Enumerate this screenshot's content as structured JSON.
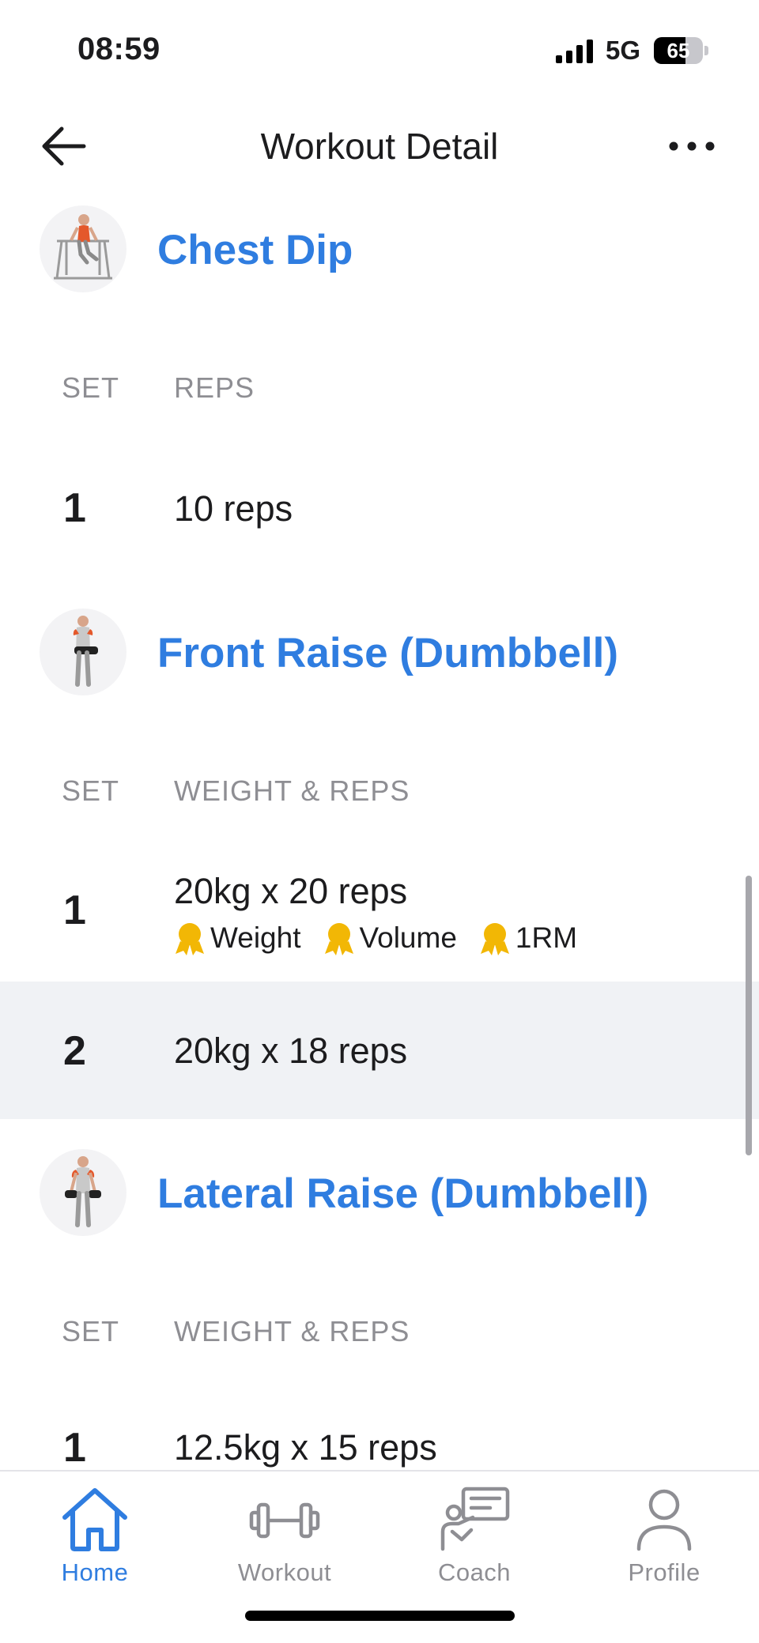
{
  "status_bar": {
    "time": "08:59",
    "network": "5G",
    "battery_level": "65",
    "battery_fraction": 0.65
  },
  "nav": {
    "title": "Workout Detail"
  },
  "exercises": [
    {
      "name": "Chest Dip",
      "columns": {
        "set": "SET",
        "detail": "REPS"
      },
      "sets": [
        {
          "number": "1",
          "detail": "10 reps"
        }
      ]
    },
    {
      "name": "Front Raise (Dumbbell)",
      "columns": {
        "set": "SET",
        "detail": "WEIGHT & REPS"
      },
      "sets": [
        {
          "number": "1",
          "detail": "20kg x 20 reps",
          "badges": [
            "Weight",
            "Volume",
            "1RM"
          ]
        },
        {
          "number": "2",
          "detail": "20kg x 18 reps"
        }
      ]
    },
    {
      "name": "Lateral Raise (Dumbbell)",
      "columns": {
        "set": "SET",
        "detail": "WEIGHT & REPS"
      },
      "sets": [
        {
          "number": "1",
          "detail": "12.5kg x 15 reps"
        }
      ]
    }
  ],
  "tab_bar": {
    "tabs": [
      {
        "label": "Home",
        "icon": "home-icon",
        "active": true
      },
      {
        "label": "Workout",
        "icon": "dumbbell-icon",
        "active": false
      },
      {
        "label": "Coach",
        "icon": "coach-icon",
        "active": false
      },
      {
        "label": "Profile",
        "icon": "person-icon",
        "active": false
      }
    ]
  },
  "colors": {
    "accent": "#2f7de0",
    "inactive": "#8e8e93",
    "highlight_row": "#f0f2f5",
    "medal": "#f2b705"
  }
}
